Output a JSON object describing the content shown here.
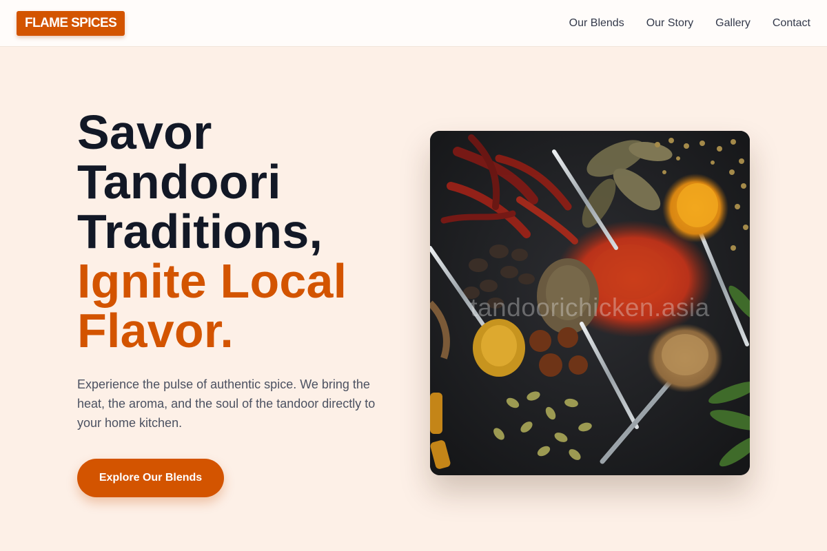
{
  "brand": {
    "logo": "FLAME SPICES",
    "accent_color": "#d35400"
  },
  "nav": {
    "items": [
      {
        "label": "Our Blends"
      },
      {
        "label": "Our Story"
      },
      {
        "label": "Gallery"
      },
      {
        "label": "Contact"
      }
    ]
  },
  "hero": {
    "headline_line1": "Savor",
    "headline_line2": "Tandoori",
    "headline_line3": "Traditions,",
    "headline_accent_line1": "Ignite Local",
    "headline_accent_line2": "Flavor.",
    "description": "Experience the pulse of authentic spice. We bring the heat, the aroma, and the soul of the tandoor directly to your home kitchen.",
    "cta_label": "Explore Our Blends",
    "image_watermark": "tandoorichicken.asia",
    "image_subject": "assorted-spices-on-spoons"
  }
}
